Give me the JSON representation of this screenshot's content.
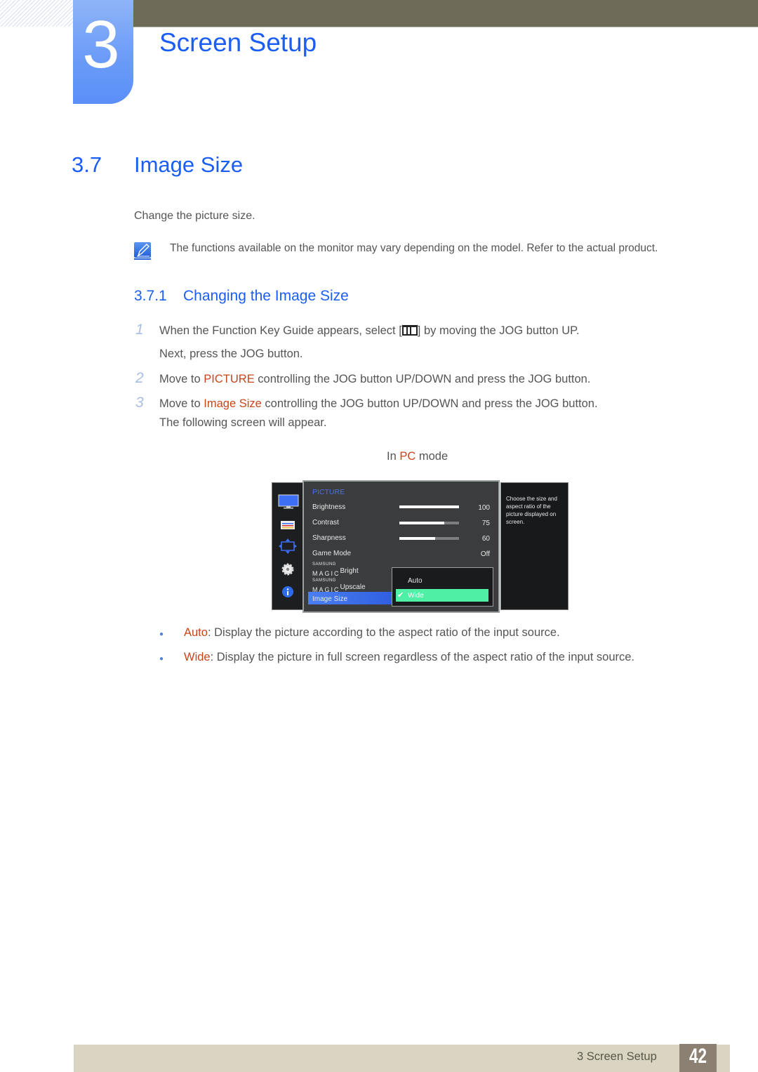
{
  "header": {
    "chapter_number": "3",
    "chapter_title": "Screen Setup",
    "accent_color": "#1a5ef5"
  },
  "section": {
    "number": "3.7",
    "title": "Image Size",
    "intro": "Change the picture size.",
    "note": "The functions available on the monitor may vary depending on the model. Refer to the actual product."
  },
  "subsection": {
    "number": "3.7.1",
    "title": "Changing the Image Size"
  },
  "steps": [
    {
      "num": "1",
      "pre": "When the Function Key Guide appears, select [",
      "post": "] by moving the JOG button UP.",
      "line2": "Next, press the JOG button."
    },
    {
      "num": "2",
      "pre": "Move to ",
      "hl": "PICTURE",
      "post": " controlling the JOG button UP/DOWN and press the JOG button."
    },
    {
      "num": "3",
      "pre": "Move to ",
      "hl": "Image Size",
      "post": " controlling the JOG button UP/DOWN and press the JOG button.",
      "line2": "The following screen will appear."
    }
  ],
  "caption": {
    "pre": "In ",
    "hl": "PC",
    "post": " mode"
  },
  "osd": {
    "menu_title": "PICTURE",
    "sidebar_icons": [
      "picture-icon",
      "color-icon",
      "size-position-icon",
      "setup-icon",
      "info-icon"
    ],
    "items": [
      {
        "label": "Brightness",
        "value": "100",
        "level": 1.0
      },
      {
        "label": "Contrast",
        "value": "75",
        "level": 0.75
      },
      {
        "label": "Sharpness",
        "value": "60",
        "level": 0.6
      },
      {
        "label": "Game Mode",
        "value": "Off"
      },
      {
        "brand_small": "SAMSUNG",
        "brand_big": "MAGIC",
        "label": "Bright"
      },
      {
        "brand_small": "SAMSUNG",
        "brand_big": "MAGIC",
        "label": "Upscale"
      },
      {
        "label": "Image Size",
        "selected": true
      }
    ],
    "options": [
      {
        "label": "Auto",
        "selected": false
      },
      {
        "label": "Wide",
        "selected": true
      }
    ],
    "check_mark": "✔",
    "info": "Choose the size and aspect ratio of the picture displayed on screen."
  },
  "bullets": [
    {
      "term": "Auto",
      "text": ": Display the picture according to the aspect ratio of the input source."
    },
    {
      "term": "Wide",
      "text": ": Display the picture in full screen regardless of the aspect ratio of the input source."
    }
  ],
  "footer": {
    "label": "3 Screen Setup",
    "page": "42"
  }
}
